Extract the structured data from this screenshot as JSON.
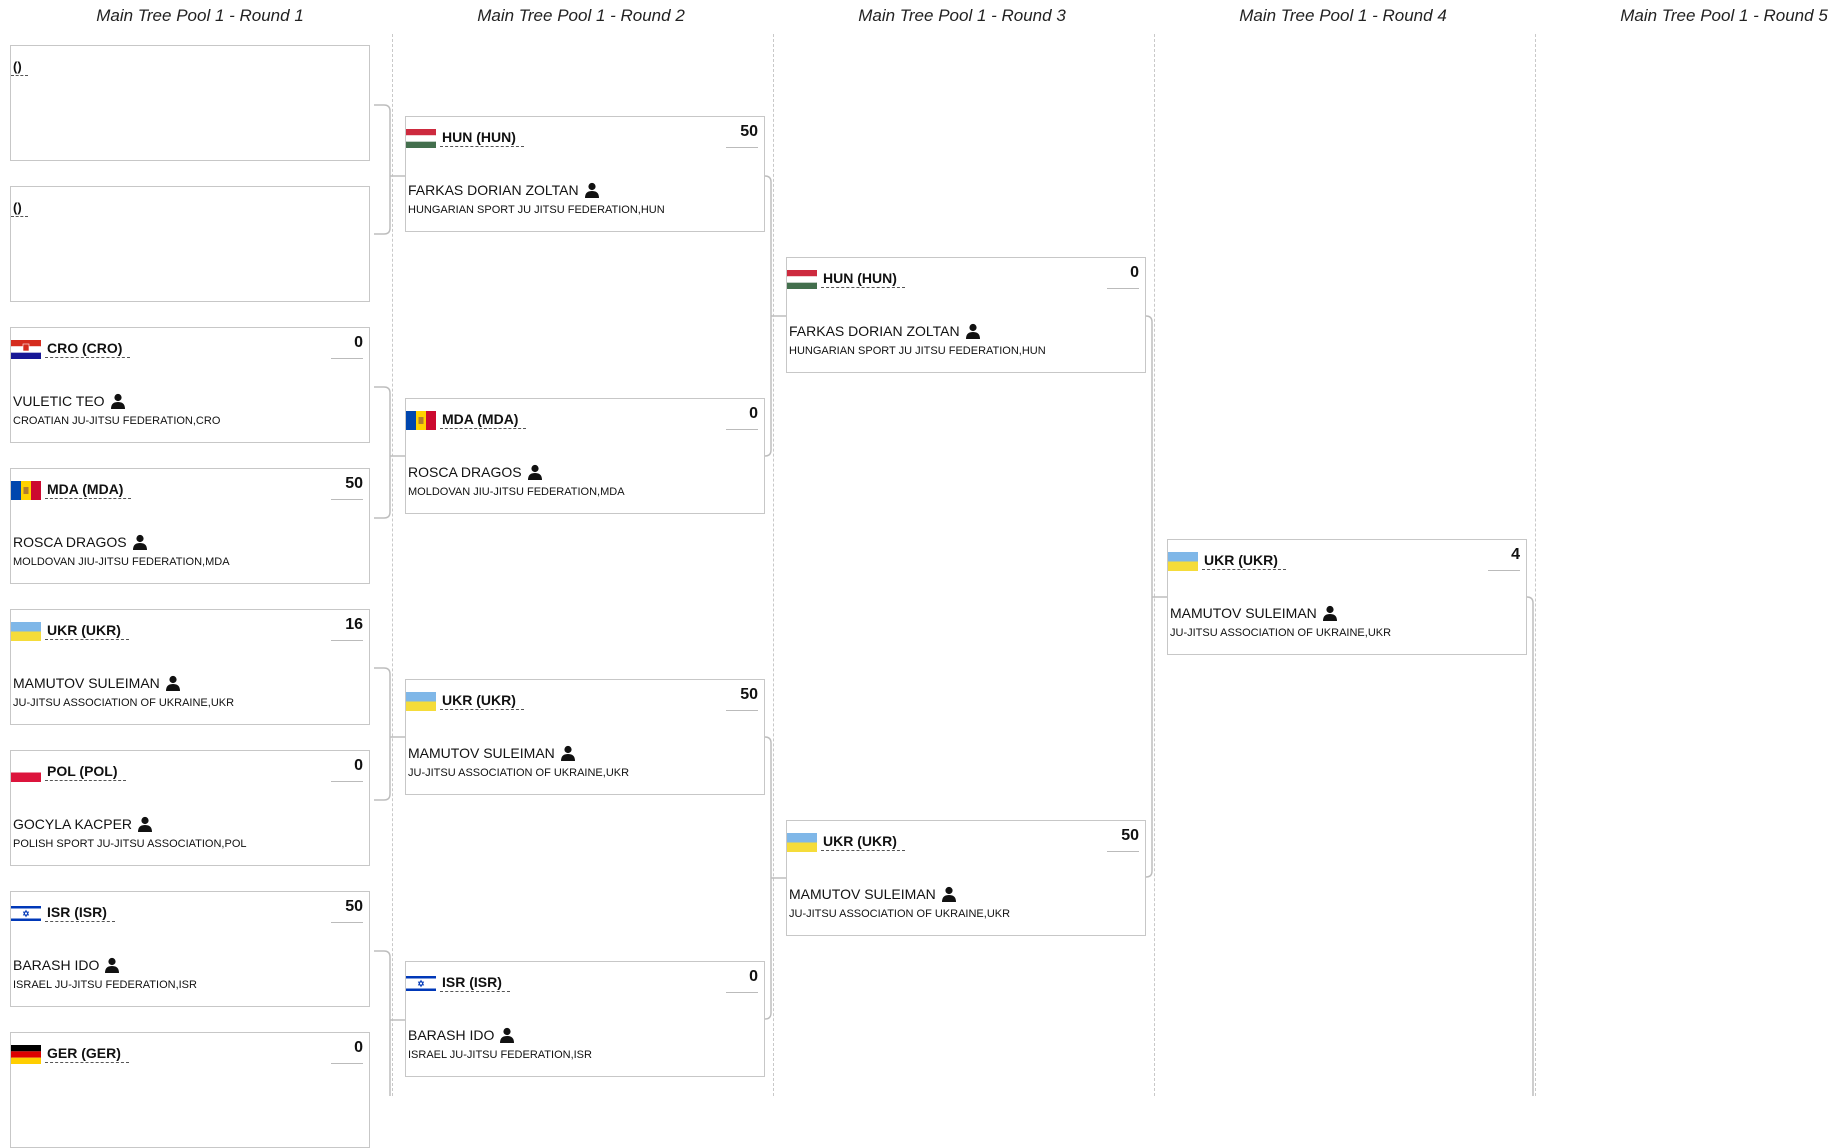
{
  "rounds": [
    {
      "title": "Main Tree Pool 1 - Round 1"
    },
    {
      "title": "Main Tree Pool 1 - Round 2"
    },
    {
      "title": "Main Tree Pool 1 - Round 3"
    },
    {
      "title": "Main Tree Pool 1 - Round 4"
    },
    {
      "title": "Main Tree Pool 1 - Round 5"
    }
  ],
  "matches": [
    {
      "team": "()",
      "flag": "",
      "score": "",
      "athlete": "",
      "club": ""
    },
    {
      "team": "()",
      "flag": "",
      "score": "",
      "athlete": "",
      "club": ""
    },
    {
      "team": "CRO (CRO)",
      "flag": "croatia-flag",
      "score": "0",
      "athlete": "VULETIC TEO",
      "club": "CROATIAN JU-JITSU FEDERATION,CRO"
    },
    {
      "team": "MDA (MDA)",
      "flag": "moldova-flag",
      "score": "50",
      "athlete": "ROSCA DRAGOS",
      "club": "MOLDOVAN JIU-JITSU FEDERATION,MDA"
    },
    {
      "team": "UKR (UKR)",
      "flag": "ukraine-flag",
      "score": "16",
      "athlete": "MAMUTOV SULEIMAN",
      "club": "JU-JITSU ASSOCIATION OF UKRAINE,UKR"
    },
    {
      "team": "POL (POL)",
      "flag": "poland-flag",
      "score": "0",
      "athlete": "GOCYLA KACPER",
      "club": "POLISH SPORT JU-JITSU ASSOCIATION,POL"
    },
    {
      "team": "ISR (ISR)",
      "flag": "israel-flag",
      "score": "50",
      "athlete": "BARASH IDO",
      "club": "ISRAEL JU-JITSU FEDERATION,ISR"
    },
    {
      "team": "GER (GER)",
      "flag": "germany-flag",
      "score": "0",
      "athlete": "",
      "club": ""
    },
    {
      "team": "HUN (HUN)",
      "flag": "hungary-flag",
      "score": "50",
      "athlete": "FARKAS DORIAN ZOLTAN",
      "club": "HUNGARIAN SPORT JU JITSU FEDERATION,HUN"
    },
    {
      "team": "MDA (MDA)",
      "flag": "moldova-flag",
      "score": "0",
      "athlete": "ROSCA DRAGOS",
      "club": "MOLDOVAN JIU-JITSU FEDERATION,MDA"
    },
    {
      "team": "UKR (UKR)",
      "flag": "ukraine-flag",
      "score": "50",
      "athlete": "MAMUTOV SULEIMAN",
      "club": "JU-JITSU ASSOCIATION OF UKRAINE,UKR"
    },
    {
      "team": "ISR (ISR)",
      "flag": "israel-flag",
      "score": "0",
      "athlete": "BARASH IDO",
      "club": "ISRAEL JU-JITSU FEDERATION,ISR"
    },
    {
      "team": "HUN (HUN)",
      "flag": "hungary-flag",
      "score": "0",
      "athlete": "FARKAS DORIAN ZOLTAN",
      "club": "HUNGARIAN SPORT JU JITSU FEDERATION,HUN"
    },
    {
      "team": "UKR (UKR)",
      "flag": "ukraine-flag",
      "score": "50",
      "athlete": "MAMUTOV SULEIMAN",
      "club": "JU-JITSU ASSOCIATION OF UKRAINE,UKR"
    },
    {
      "team": "UKR (UKR)",
      "flag": "ukraine-flag",
      "score": "4",
      "athlete": "MAMUTOV SULEIMAN",
      "club": "JU-JITSU ASSOCIATION OF UKRAINE,UKR"
    }
  ],
  "colors": {
    "border": "#c7c7c7",
    "connector": "#bdbdbd",
    "divider": "#c9c9c9"
  }
}
